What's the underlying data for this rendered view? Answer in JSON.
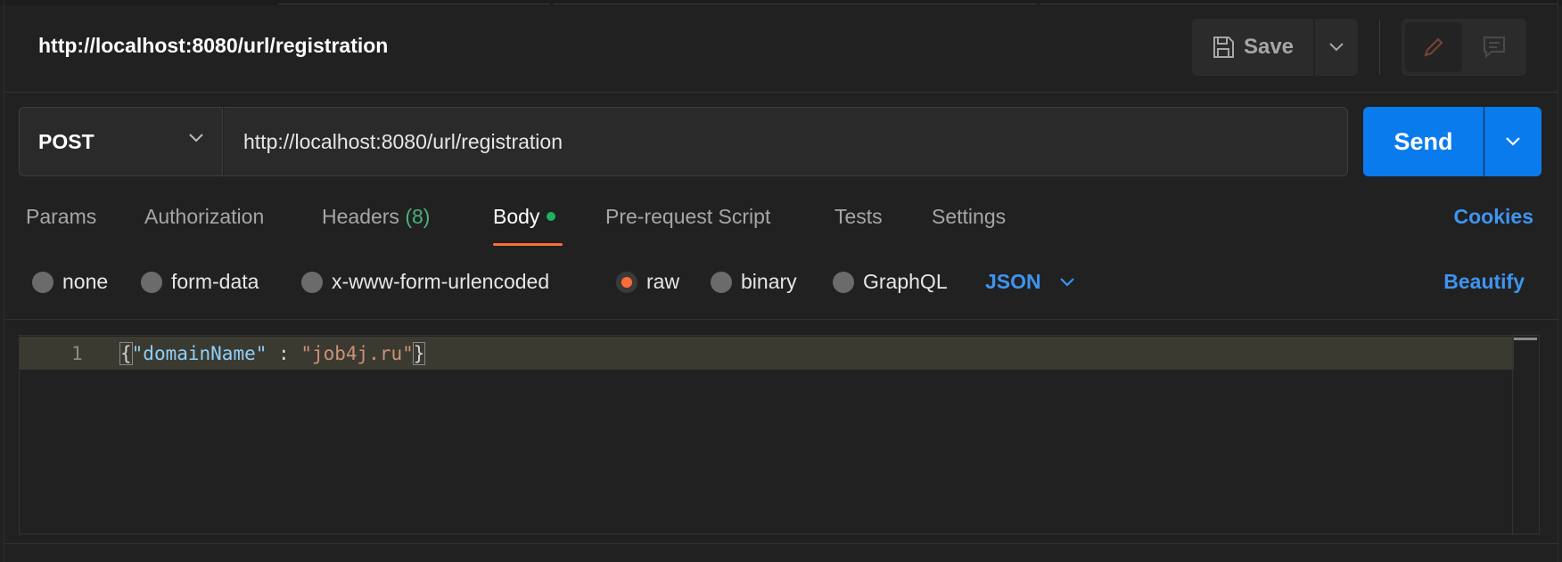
{
  "request": {
    "title": "http://localhost:8080/url/registration",
    "method": "POST",
    "url": "http://localhost:8080/url/registration"
  },
  "toolbar": {
    "save_label": "Save",
    "send_label": "Send"
  },
  "tabs": [
    {
      "label": "Params"
    },
    {
      "label": "Authorization"
    },
    {
      "label": "Headers",
      "count": "(8)"
    },
    {
      "label": "Body",
      "active": true
    },
    {
      "label": "Pre-request Script"
    },
    {
      "label": "Tests"
    },
    {
      "label": "Settings"
    }
  ],
  "cookies_label": "Cookies",
  "body_options": {
    "types": [
      "none",
      "form-data",
      "x-www-form-urlencoded",
      "raw",
      "binary",
      "GraphQL"
    ],
    "selected": "raw",
    "format": "JSON",
    "beautify_label": "Beautify"
  },
  "editor": {
    "line_number": "1",
    "open_brace": "{",
    "key": "\"domainName\"",
    "separator": " : ",
    "value": "\"job4j.ru\"",
    "close_brace": "}"
  },
  "colors": {
    "accent_orange": "#ff6c37",
    "send_blue": "#097bed",
    "link_blue": "#3e94f0",
    "status_green": "#1fb25c"
  },
  "icons": {
    "save": "save-icon",
    "edit": "pencil-icon",
    "comment": "comment-icon",
    "dropdown": "chevron-down-icon"
  }
}
